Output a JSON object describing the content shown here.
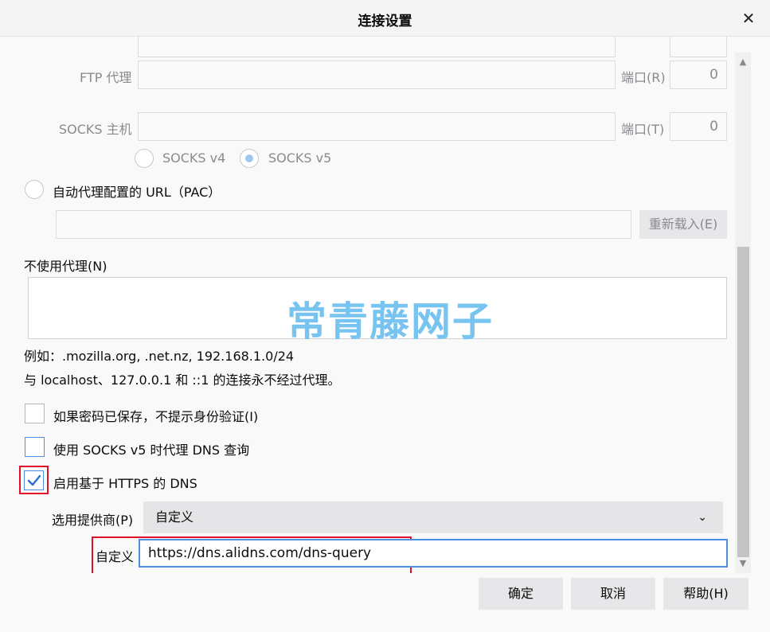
{
  "window": {
    "title": "连接设置",
    "close_glyph": "✕"
  },
  "ftp": {
    "label": "FTP 代理",
    "host_value": "",
    "port_label": "端口(R)",
    "port_value": "0"
  },
  "socks": {
    "label": "SOCKS 主机",
    "host_value": "",
    "port_label": "端口(T)",
    "port_value": "0",
    "v4_label": "SOCKS v4",
    "v5_label": "SOCKS v5"
  },
  "pac": {
    "label": "自动代理配置的 URL（PAC）",
    "url_value": "",
    "reload_label": "重新载入(E)"
  },
  "no_proxy": {
    "label": "不使用代理(N)",
    "value": "",
    "example": "例如：.mozilla.org, .net.nz, 192.168.1.0/24",
    "note": "与 localhost、127.0.0.1 和 ::1 的连接永不经过代理。"
  },
  "checkboxes": {
    "save_password": "如果密码已保存，不提示身份验证(I)",
    "socks_dns": "使用 SOCKS v5 时代理 DNS 查询",
    "https_dns": "启用基于 HTTPS 的 DNS"
  },
  "provider": {
    "label": "选用提供商(P)",
    "selected": "自定义"
  },
  "custom": {
    "label": "自定义",
    "value": "https://dns.alidns.com/dns-query"
  },
  "watermark": "常青藤网子",
  "buttons": {
    "ok": "确定",
    "cancel": "取消",
    "help": "帮助(H)"
  },
  "colors": {
    "accent": "#4a8fe0",
    "highlight": "#e0102a",
    "watermark": "#78c4f0"
  }
}
